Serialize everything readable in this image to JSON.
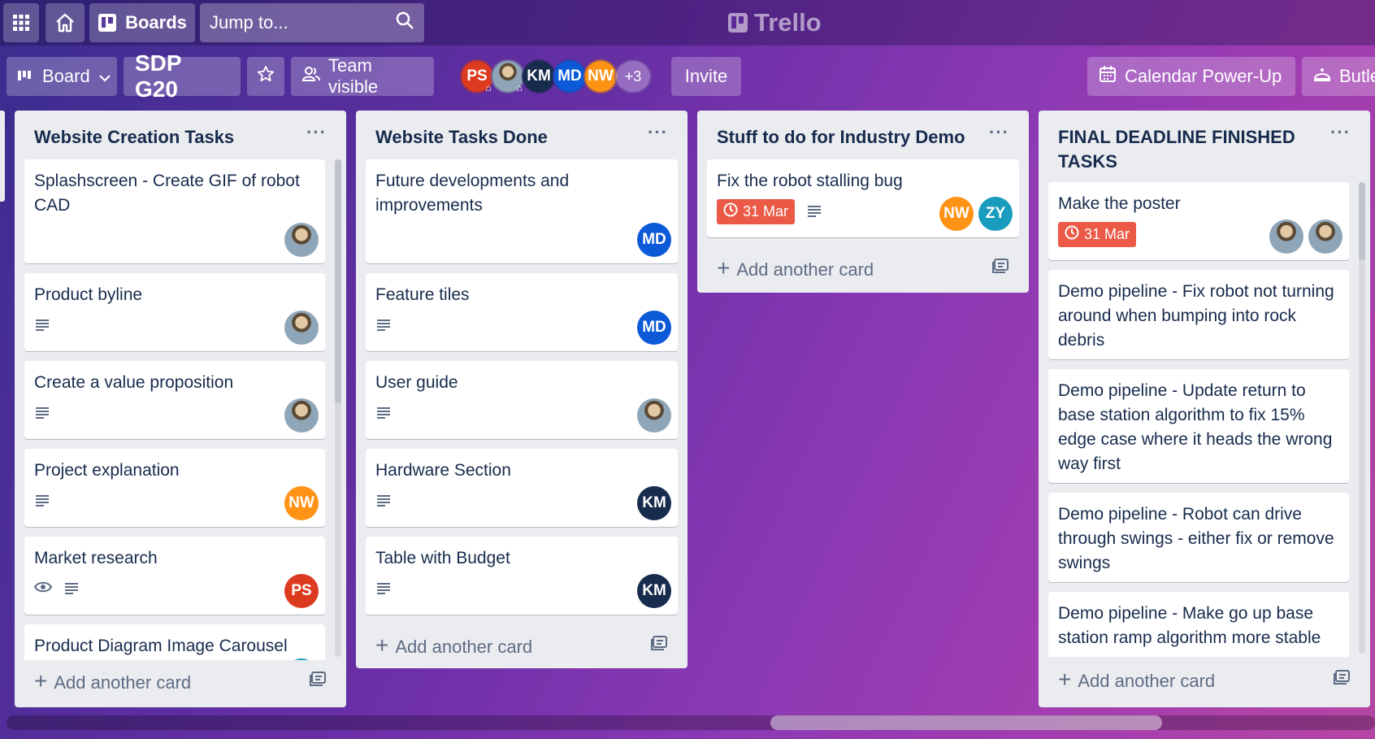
{
  "header": {
    "apps_icon": "grid-icon",
    "home_icon": "home-icon",
    "boards_label": "Boards",
    "search_placeholder": "Jump to...",
    "logo_text": "Trello"
  },
  "board_bar": {
    "view_label": "Board",
    "board_name": "SDP G20",
    "visibility_label": "Team visible",
    "members": [
      "PS",
      "",
      "KM",
      "MD",
      "NW"
    ],
    "more_members": "+3",
    "invite_label": "Invite",
    "calendar_label": "Calendar Power-Up",
    "butler_label": "Butle"
  },
  "colors": {
    "due_red": "#eb5a46",
    "ps": "#dd3b1f",
    "km": "#172b4d",
    "md": "#0c5ad8",
    "nw": "#ff9316",
    "zy": "#1a9cbe"
  },
  "lists": [
    {
      "title": "Website Creation Tasks",
      "cards": [
        {
          "title": "Splashscreen - Create GIF of robot CAD",
          "members": [
            "photo"
          ]
        },
        {
          "title": "Product byline",
          "desc": true,
          "members": [
            "photo"
          ]
        },
        {
          "title": "Create a value proposition",
          "desc": true,
          "members": [
            "photo"
          ]
        },
        {
          "title": "Project explanation",
          "desc": true,
          "members": [
            "NW"
          ]
        },
        {
          "title": "Market research",
          "watch": true,
          "desc": true,
          "members": [
            "PS"
          ]
        },
        {
          "title": "Product Diagram Image Carousel",
          "members": []
        }
      ],
      "add_label": "Add another card"
    },
    {
      "title": "Website Tasks Done",
      "cards": [
        {
          "title": "Future developments and improvements",
          "members": [
            "MD"
          ]
        },
        {
          "title": "Feature tiles",
          "desc": true,
          "members": [
            "MD"
          ]
        },
        {
          "title": "User guide",
          "desc": true,
          "members": [
            "photo"
          ]
        },
        {
          "title": "Hardware Section",
          "desc": true,
          "members": [
            "KM"
          ]
        },
        {
          "title": "Table with Budget",
          "desc": true,
          "members": [
            "KM"
          ]
        }
      ],
      "add_label": "Add another card"
    },
    {
      "title": "Stuff to do for Industry Demo",
      "cards": [
        {
          "title": "Fix the robot stalling bug",
          "due": "31 Mar",
          "desc": true,
          "members": [
            "NW",
            "ZY"
          ]
        }
      ],
      "add_label": "Add another card"
    },
    {
      "title": "FINAL DEADLINE FINISHED TASKS",
      "cards": [
        {
          "title": "Make the poster",
          "due": "31 Mar",
          "members": [
            "photo",
            "photo"
          ]
        },
        {
          "title": "Demo pipeline - Fix robot not turning around when bumping into rock debris"
        },
        {
          "title": "Demo pipeline - Update return to base station algorithm to fix 15% edge case where it heads the wrong way first"
        },
        {
          "title": "Demo pipeline - Robot can drive through swings - either fix or remove swings"
        },
        {
          "title": "Demo pipeline - Make go up base station ramp algorithm more stable"
        }
      ],
      "add_label": "Add another card"
    }
  ]
}
